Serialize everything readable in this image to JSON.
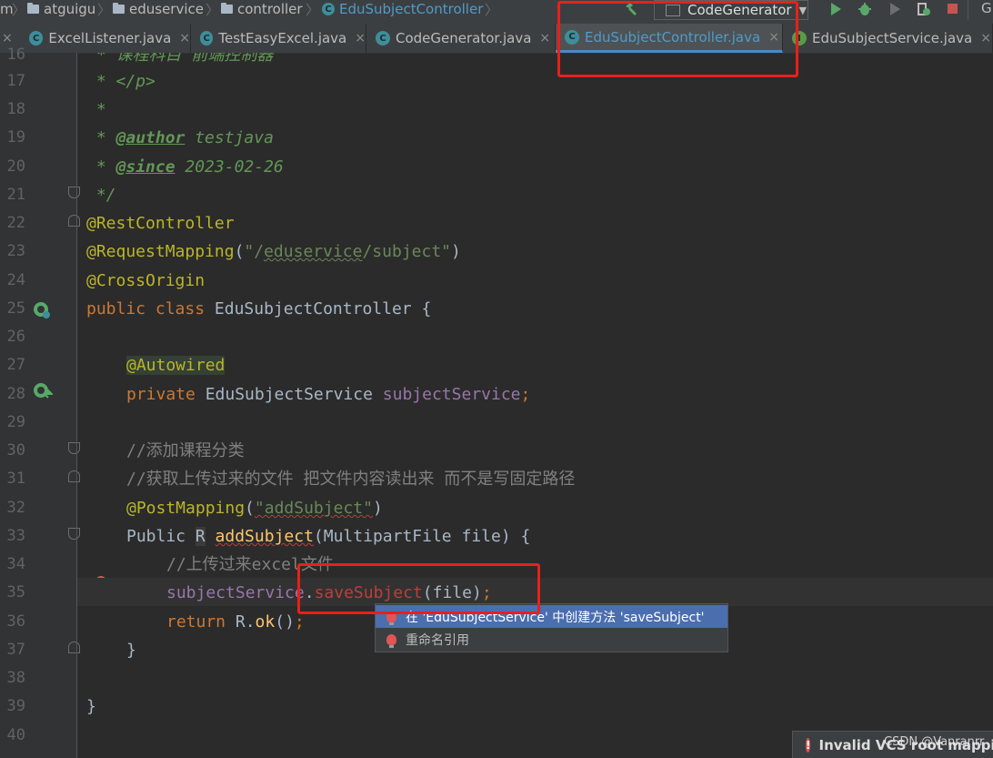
{
  "breadcrumb": {
    "items": [
      "m",
      "atguigu",
      "eduservice",
      "controller",
      "EduSubjectController"
    ]
  },
  "toolbar": {
    "run_config": "CodeGenerator",
    "trailing_text": "G"
  },
  "tabs": [
    {
      "label": "ExcelListener.java",
      "icon": "class-icon",
      "active": false
    },
    {
      "label": "TestEasyExcel.java",
      "icon": "class-icon",
      "active": false
    },
    {
      "label": "CodeGenerator.java",
      "icon": "class-icon",
      "active": false
    },
    {
      "label": "EduSubjectController.java",
      "icon": "class-icon",
      "active": true
    },
    {
      "label": "EduSubjectService.java",
      "icon": "interface-icon",
      "active": false
    }
  ],
  "editor": {
    "line_numbers": [
      "16",
      "17",
      "18",
      "19",
      "20",
      "21",
      "22",
      "23",
      "24",
      "25",
      "26",
      "27",
      "28",
      "29",
      "30",
      "31",
      "32",
      "33",
      "34",
      "35",
      "36",
      "37",
      "38",
      "39",
      "40"
    ],
    "code": {
      "l16_cmt": " * 课程科目 前端控制器",
      "l17_cmt": " * </p>",
      "l18_cmt": " *",
      "l19_star": " * ",
      "l19_tag": "@author",
      "l19_val": " testjava",
      "l20_star": " * ",
      "l20_tag": "@since",
      "l20_val": " 2023-02-26",
      "l21_cmt": " */",
      "l22": "@RestController",
      "l23_ann": "@RequestMapping",
      "l23_open": "(",
      "l23_q1": "\"/",
      "l23_path": "eduservice",
      "l23_rest": "/subject\"",
      "l23_close": ")",
      "l24": "@CrossOrigin",
      "l25_kw": "public class ",
      "l25_name": "EduSubjectController {",
      "l27": "@Autowired",
      "l28_kw": "private ",
      "l28_type": "EduSubjectService ",
      "l28_field": "subjectService",
      "l28_semi": ";",
      "l30": "//添加课程分类",
      "l31": "//获取上传过来的文件 把文件内容读出来 而不是写固定路径",
      "l32_ann": "@PostMapping",
      "l32_open": "(",
      "l32_str": "\"addSubject\"",
      "l32_close": ")",
      "l33_pub": "Public ",
      "l33_r": "R",
      "l33_sp": " ",
      "l33_fn": "addSubject",
      "l33_rest": "(MultipartFile file) {",
      "l34": "//上传过来excel文件",
      "l35_field": "subjectService",
      "l35_dot": ".",
      "l35_err": "saveSubject",
      "l35_rest": "(file)",
      "l35_semi": ";",
      "l36_kw": "return ",
      "l36_r": "R.",
      "l36_fn": "ok",
      "l36_rest": "()",
      "l36_semi": ";",
      "l37": "}",
      "l39": "}"
    }
  },
  "popup": {
    "items": [
      "在 'EduSubjectService' 中创建方法 'saveSubject'",
      "重命名引用"
    ]
  },
  "notification": {
    "text": "Invalid VCS root mapping"
  },
  "watermark": "CSDN @Vanranrr",
  "colors": {
    "editor_bg": "#2b2b2b",
    "gutter_bg": "#313335",
    "keyword": "#cc7832",
    "annotation": "#bbb529",
    "string": "#6a8759",
    "field": "#9876aa",
    "method": "#ffc66d",
    "comment": "#808080",
    "doc_comment": "#629755",
    "error": "#bc3f3c",
    "selection": "#4b6eaf",
    "annotation_box": "#e8201c"
  }
}
